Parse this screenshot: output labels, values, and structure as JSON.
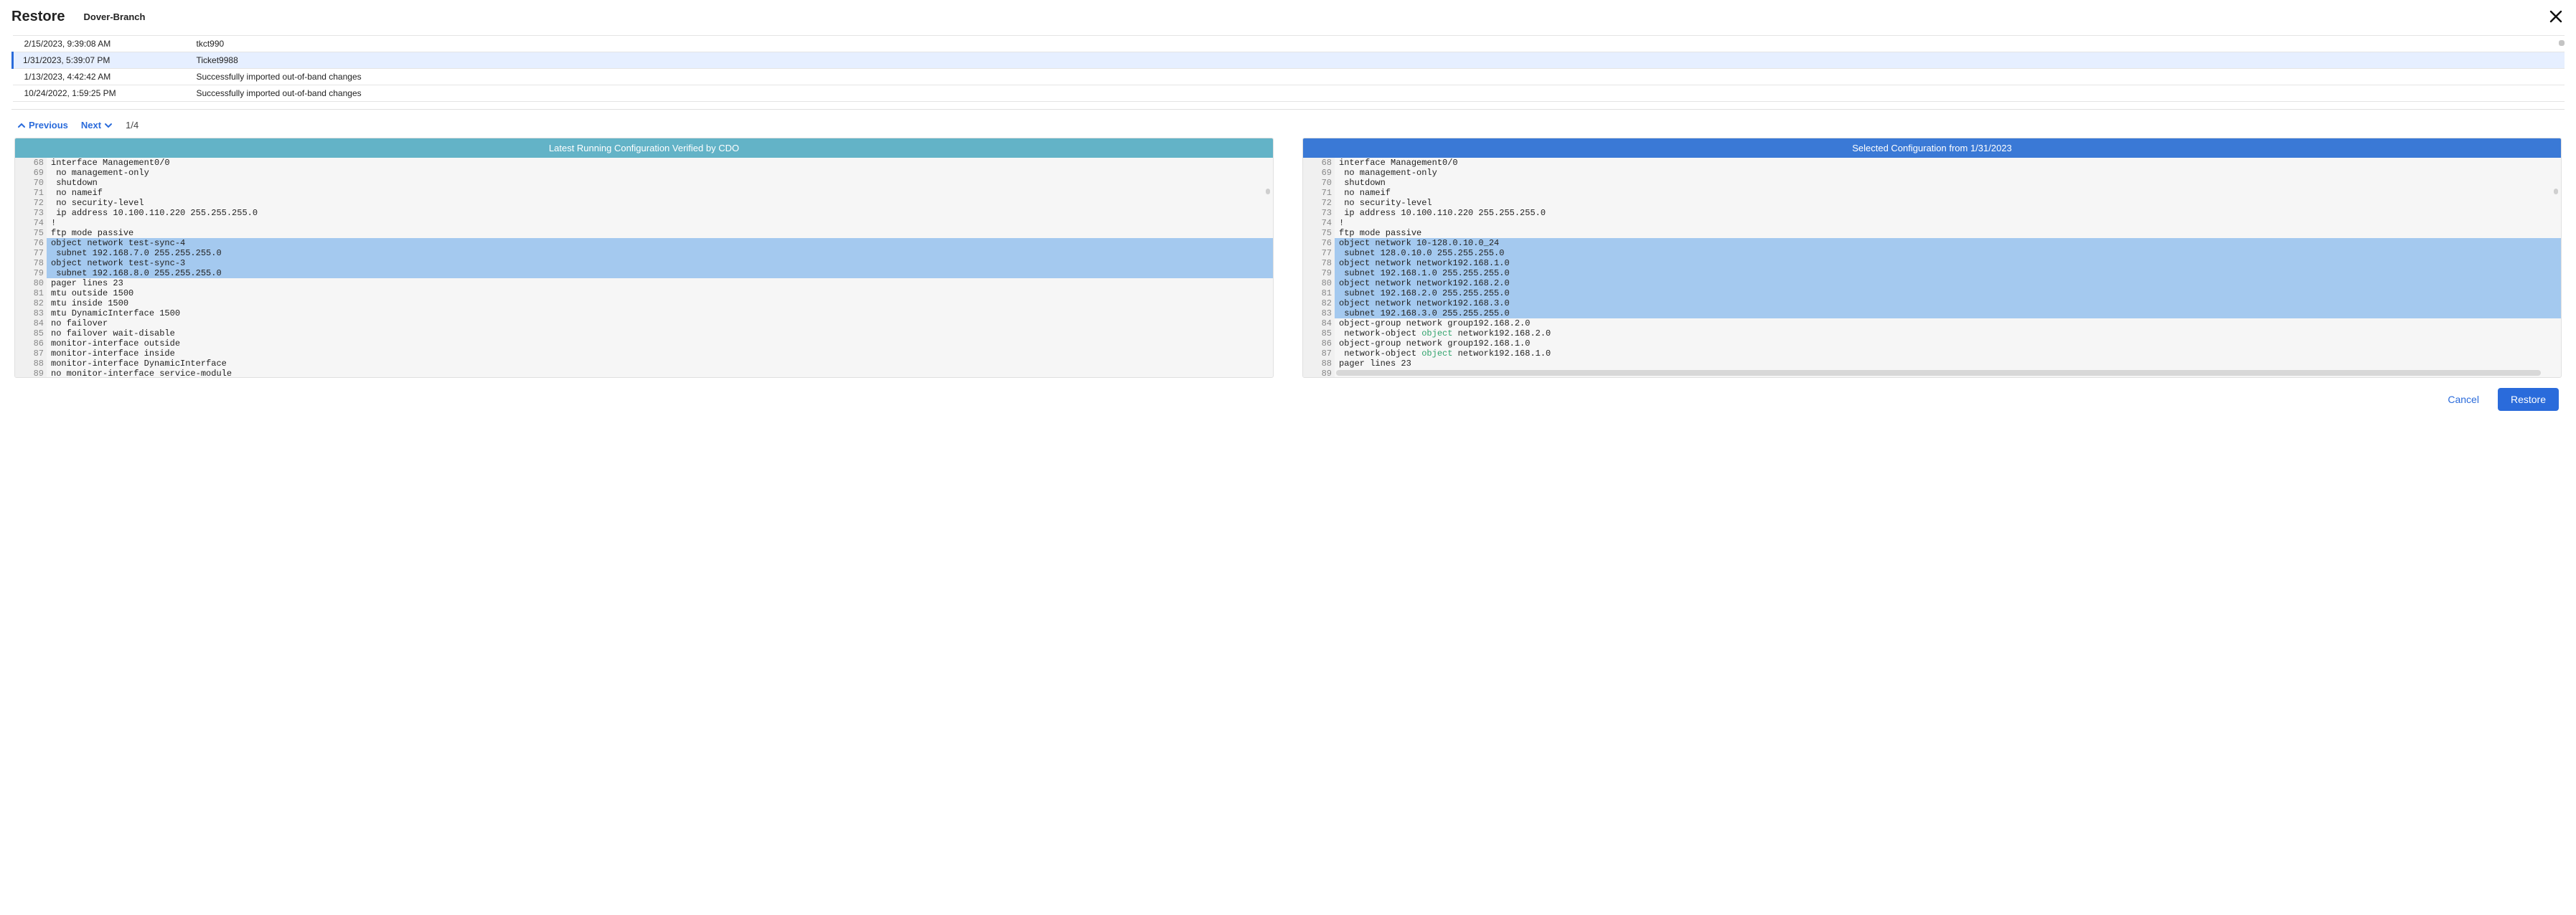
{
  "header": {
    "title": "Restore",
    "device": "Dover-Branch"
  },
  "snapshots": [
    {
      "date": "2/15/2023, 9:39:08 AM",
      "desc": "tkct990",
      "selected": false
    },
    {
      "date": "1/31/2023, 5:39:07 PM",
      "desc": "Ticket9988",
      "selected": true
    },
    {
      "date": "1/13/2023, 4:42:42 AM",
      "desc": "Successfully imported out-of-band changes",
      "selected": false
    },
    {
      "date": "10/24/2022, 1:59:25 PM",
      "desc": "Successfully imported out-of-band changes",
      "selected": false
    }
  ],
  "pager": {
    "prev": "Previous",
    "next": "Next",
    "count": "1/4"
  },
  "diff": {
    "left_title": "Latest Running Configuration Verified by CDO",
    "right_title": "Selected Configuration from 1/31/2023",
    "left": [
      {
        "n": 68,
        "t": "interface Management0/0"
      },
      {
        "n": 69,
        "t": " no management-only"
      },
      {
        "n": 70,
        "t": " shutdown"
      },
      {
        "n": 71,
        "t": " no nameif"
      },
      {
        "n": 72,
        "t": " no security-level"
      },
      {
        "n": 73,
        "t": " ip address 10.100.110.220 255.255.255.0"
      },
      {
        "n": 74,
        "t": "!"
      },
      {
        "n": 75,
        "t": "ftp mode passive"
      },
      {
        "n": 76,
        "t": "object network test-sync-4",
        "hl": true
      },
      {
        "n": 77,
        "t": " subnet 192.168.7.0 255.255.255.0",
        "hl": true
      },
      {
        "n": 78,
        "t": "object network test-sync-3",
        "hl": true
      },
      {
        "n": 79,
        "t": " subnet 192.168.8.0 255.255.255.0",
        "hl": true
      },
      {
        "n": 80,
        "t": "pager lines 23"
      },
      {
        "n": 81,
        "t": "mtu outside 1500"
      },
      {
        "n": 82,
        "t": "mtu inside 1500"
      },
      {
        "n": 83,
        "t": "mtu DynamicInterface 1500"
      },
      {
        "n": 84,
        "t": "no failover"
      },
      {
        "n": 85,
        "t": "no failover wait-disable"
      },
      {
        "n": 86,
        "t": "monitor-interface outside"
      },
      {
        "n": 87,
        "t": "monitor-interface inside"
      },
      {
        "n": 88,
        "t": "monitor-interface DynamicInterface"
      },
      {
        "n": 89,
        "t": "no monitor-interface service-module"
      }
    ],
    "right": [
      {
        "n": 68,
        "t": "interface Management0/0"
      },
      {
        "n": 69,
        "t": " no management-only"
      },
      {
        "n": 70,
        "t": " shutdown"
      },
      {
        "n": 71,
        "t": " no nameif"
      },
      {
        "n": 72,
        "t": " no security-level"
      },
      {
        "n": 73,
        "t": " ip address 10.100.110.220 255.255.255.0"
      },
      {
        "n": 74,
        "t": "!"
      },
      {
        "n": 75,
        "t": "ftp mode passive"
      },
      {
        "n": 76,
        "t": "object network 10-128.0.10.0_24",
        "hl": true
      },
      {
        "n": 77,
        "t": " subnet 128.0.10.0 255.255.255.0",
        "hl": true
      },
      {
        "n": 78,
        "t": "object network network192.168.1.0",
        "hl": true
      },
      {
        "n": 79,
        "t": " subnet 192.168.1.0 255.255.255.0",
        "hl": true
      },
      {
        "n": 80,
        "t": "object network network192.168.2.0",
        "hl": true
      },
      {
        "n": 81,
        "t": " subnet 192.168.2.0 255.255.255.0",
        "hl": true
      },
      {
        "n": 82,
        "t": "object network network192.168.3.0",
        "hl": true
      },
      {
        "n": 83,
        "t": " subnet 192.168.3.0 255.255.255.0",
        "hl": true
      },
      {
        "n": 84,
        "t": "object-group network group192.168.2.0"
      },
      {
        "n": 85,
        "t": " network-object ",
        "kw": "object",
        "t2": " network192.168.2.0"
      },
      {
        "n": 86,
        "t": "object-group network group192.168.1.0"
      },
      {
        "n": 87,
        "t": " network-object ",
        "kw": "object",
        "t2": " network192.168.1.0"
      },
      {
        "n": 88,
        "t": "pager lines 23"
      },
      {
        "n": 89,
        "t": ""
      }
    ]
  },
  "footer": {
    "cancel": "Cancel",
    "restore": "Restore"
  }
}
